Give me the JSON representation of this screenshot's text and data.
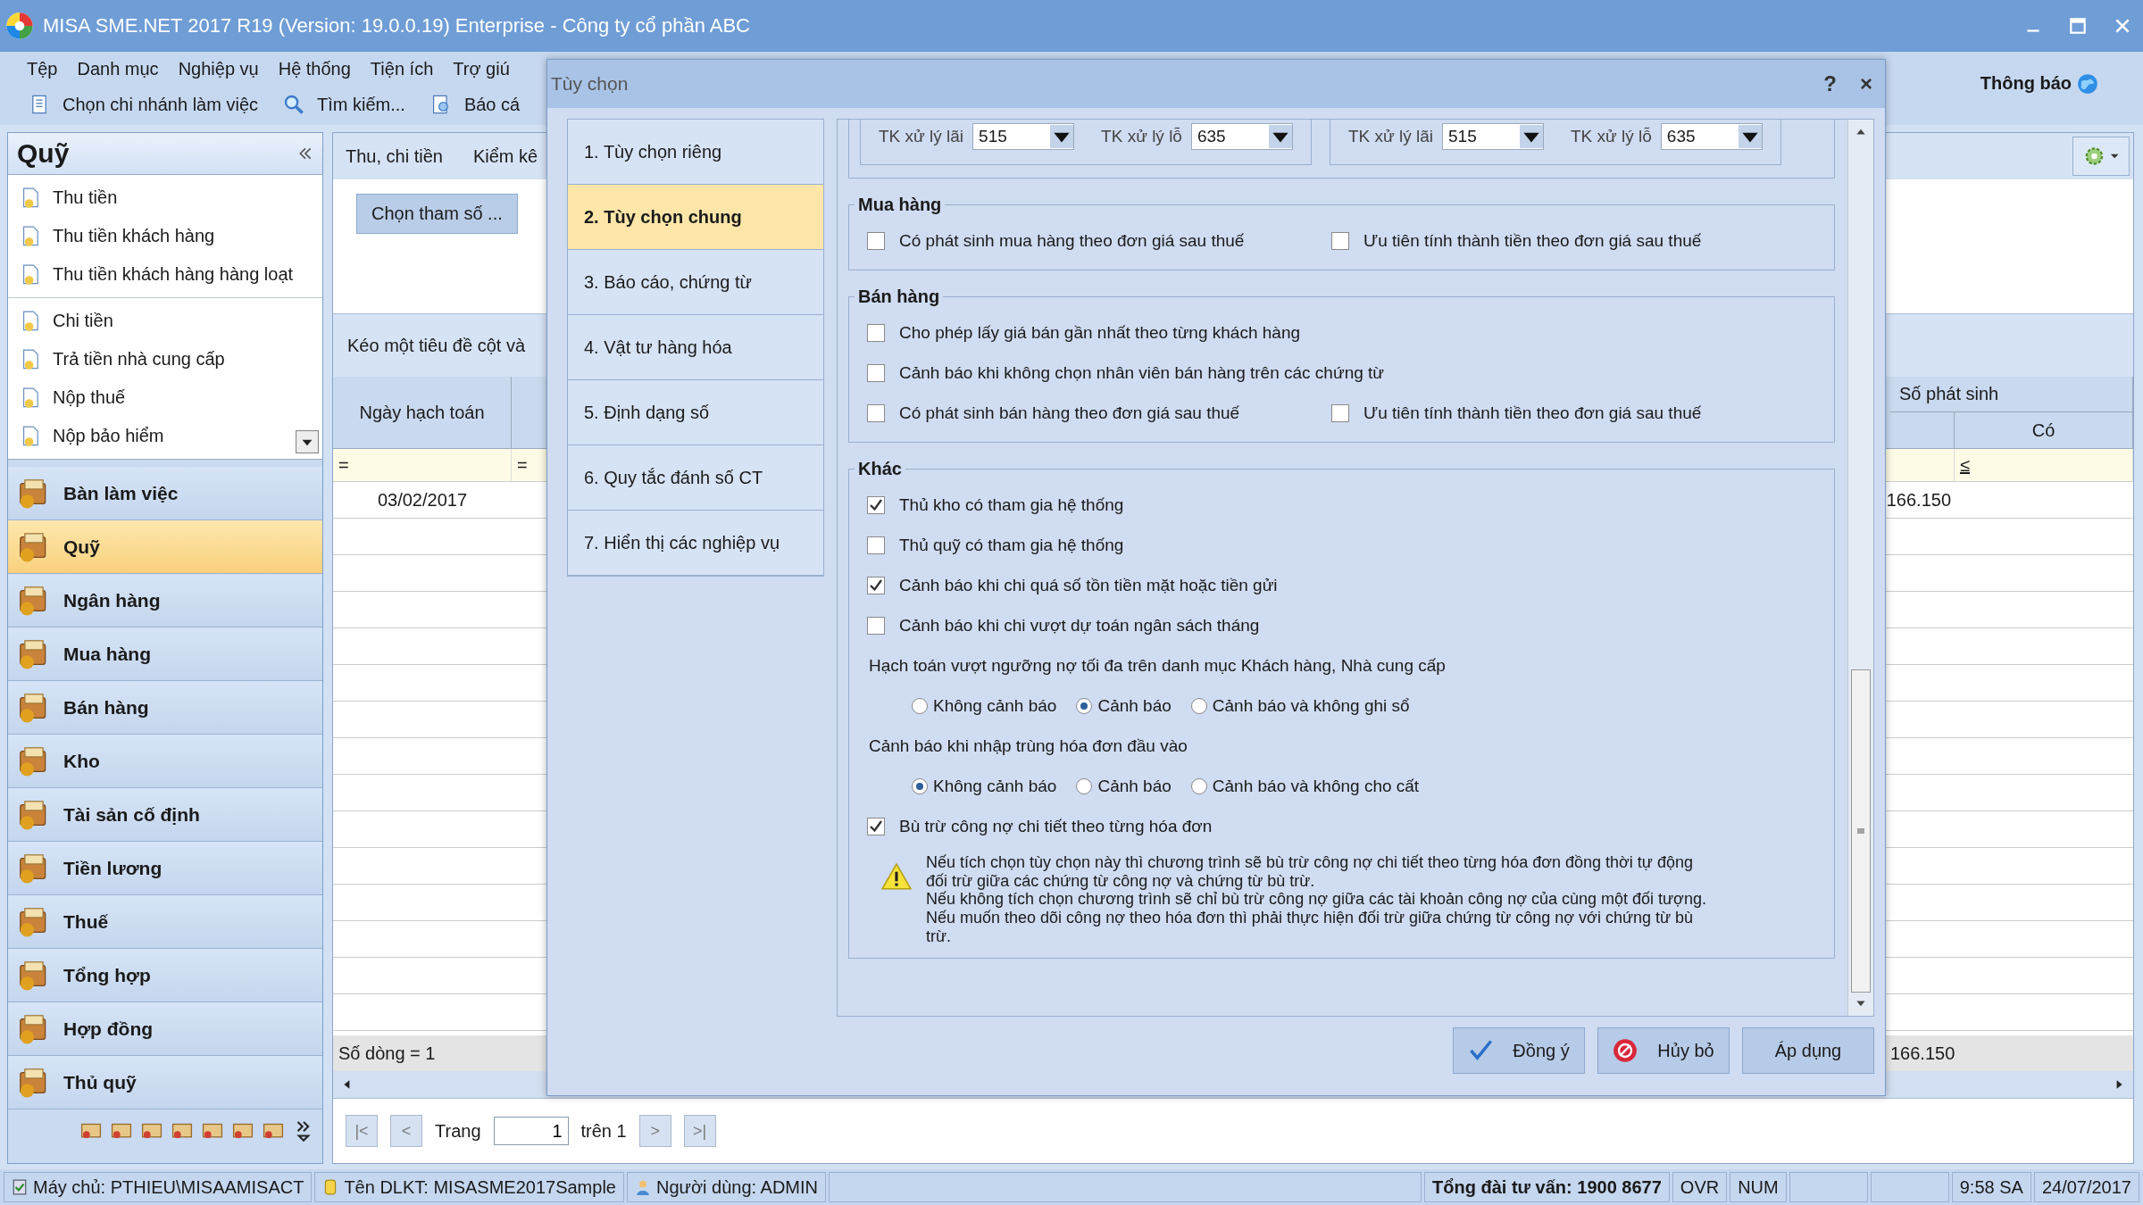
{
  "window": {
    "title": "MISA SME.NET 2017 R19 (Version: 19.0.0.19) Enterprise - Công ty cổ phần ABC"
  },
  "menu": [
    "Tệp",
    "Danh mục",
    "Nghiệp vụ",
    "Hệ thống",
    "Tiện ích",
    "Trợ giú"
  ],
  "toolbar": [
    {
      "kind": "branch",
      "label": "Chọn chi nhánh làm việc"
    },
    {
      "kind": "search",
      "label": "Tìm kiếm..."
    },
    {
      "kind": "report",
      "label": "Báo cá"
    }
  ],
  "notification": "Thông báo",
  "sidebar": {
    "title": "Quỹ",
    "task_groups": [
      [
        "Thu tiền",
        "Thu tiền khách hàng",
        "Thu tiền khách hàng hàng loạt"
      ],
      [
        "Chi tiền",
        "Trả tiền nhà cung cấp",
        "Nộp thuế",
        "Nộp bảo hiểm"
      ]
    ],
    "modules": [
      {
        "label": "Bàn làm việc",
        "selected": false
      },
      {
        "label": "Quỹ",
        "selected": true
      },
      {
        "label": "Ngân hàng",
        "selected": false
      },
      {
        "label": "Mua hàng",
        "selected": false
      },
      {
        "label": "Bán hàng",
        "selected": false
      },
      {
        "label": "Kho",
        "selected": false
      },
      {
        "label": "Tài sản cố định",
        "selected": false
      },
      {
        "label": "Tiền lương",
        "selected": false
      },
      {
        "label": "Thuế",
        "selected": false
      },
      {
        "label": "Tổng hợp",
        "selected": false
      },
      {
        "label": "Hợp đồng",
        "selected": false
      },
      {
        "label": "Thủ quỹ",
        "selected": false
      }
    ]
  },
  "main": {
    "tabs": [
      "Thu, chi tiền",
      "Kiểm kê"
    ],
    "params_button": "Chọn tham số ...",
    "group_hint": "Kéo một tiêu đề cột và",
    "grid": {
      "col_date": "Ngày hạch toán",
      "filter_ops": [
        "=",
        "="
      ],
      "date": "03/02/2017",
      "group_header": "Số phát sinh",
      "col_credit": "Có",
      "credit_filter": "≤",
      "amount": "166.150",
      "row_count": "Số dòng = 1",
      "total": "166.150"
    },
    "pager": {
      "first": "|<",
      "prev": "<",
      "page_label": "Trang",
      "page": "1",
      "of": "trên 1",
      "next": ">",
      "last": ">|"
    }
  },
  "dialog": {
    "title": "Tùy chọn",
    "title_buttons": [
      "?",
      "×"
    ],
    "nav": [
      {
        "label": "1. Tùy chọn riêng",
        "selected": false
      },
      {
        "label": "2. Tùy chọn chung",
        "selected": true
      },
      {
        "label": "3. Báo cáo, chứng từ",
        "selected": false
      },
      {
        "label": "4. Vật tư hàng hóa",
        "selected": false
      },
      {
        "label": "5. Định dạng số",
        "selected": false
      },
      {
        "label": "6. Quy tắc đánh số CT",
        "selected": false
      },
      {
        "label": "7. Hiển thị các nghiệp vụ",
        "selected": false
      }
    ],
    "accounts": [
      [
        {
          "label": "TK xử lý lãi",
          "value": "515"
        },
        {
          "label": "TK xử lý lỗ",
          "value": "635"
        }
      ],
      [
        {
          "label": "TK xử lý lãi",
          "value": "515"
        },
        {
          "label": "TK xử lý lỗ",
          "value": "635"
        }
      ]
    ],
    "sections": [
      {
        "title": "Mua hàng",
        "rows": [
          [
            {
              "label": "Có phát sinh mua hàng theo đơn giá sau thuế",
              "checked": false
            },
            {
              "label": "Ưu tiên tính thành tiền theo đơn giá sau thuế",
              "checked": false
            }
          ]
        ]
      },
      {
        "title": "Bán hàng",
        "rows": [
          [
            {
              "label": "Cho phép lấy giá bán gần nhất theo từng khách hàng",
              "checked": false
            }
          ],
          [
            {
              "label": "Cảnh báo khi không chọn nhân viên bán hàng trên các chứng từ",
              "checked": false
            }
          ],
          [
            {
              "label": "Có phát sinh bán hàng theo đơn giá sau thuế",
              "checked": false
            },
            {
              "label": "Ưu tiên tính thành tiền theo đơn giá sau thuế",
              "checked": false
            }
          ]
        ]
      }
    ],
    "other": {
      "title": "Khác",
      "items": [
        {
          "kind": "checkbox",
          "label": "Thủ kho có tham gia hệ thống",
          "checked": true
        },
        {
          "kind": "checkbox",
          "label": "Thủ quỹ có tham gia hệ thống",
          "checked": false
        },
        {
          "kind": "checkbox",
          "label": "Cảnh báo khi chi quá số tồn tiền mặt hoặc tiền gửi",
          "checked": true
        },
        {
          "kind": "checkbox",
          "label": "Cảnh báo khi chi vượt dự toán ngân sách tháng",
          "checked": false
        },
        {
          "kind": "label",
          "label": "Hạch toán vượt ngưỡng nợ tối đa trên danh mục Khách hàng, Nhà cung cấp"
        },
        {
          "kind": "radios",
          "options": [
            {
              "label": "Không cảnh báo",
              "selected": false
            },
            {
              "label": "Cảnh báo",
              "selected": true
            },
            {
              "label": "Cảnh báo và không ghi sổ",
              "selected": false
            }
          ]
        },
        {
          "kind": "label",
          "label": "Cảnh báo khi nhập trùng hóa đơn đầu vào"
        },
        {
          "kind": "radios",
          "options": [
            {
              "label": "Không cảnh báo",
              "selected": true
            },
            {
              "label": "Cảnh báo",
              "selected": false
            },
            {
              "label": "Cảnh báo và không cho cất",
              "selected": false
            }
          ]
        },
        {
          "kind": "checkbox",
          "label": "Bù trừ công nợ chi tiết theo từng hóa đơn",
          "checked": true
        },
        {
          "kind": "note",
          "paragraphs": [
            "Nếu tích chọn tùy chọn này thì chương trình sẽ bù trừ công nợ chi tiết theo từng hóa đơn đồng thời tự động đối trừ giữa các chứng từ công nợ và chứng từ bù trừ.",
            "Nếu không tích chọn chương trình sẽ chỉ bù trừ công nợ giữa các tài khoản công nợ của cùng một đối tượng. Nếu muốn theo dõi công nợ theo hóa đơn thì phải thực hiện đối trừ giữa chứng từ công nợ với chứng từ bù trừ."
          ]
        }
      ]
    },
    "buttons": [
      {
        "kind": "ok",
        "label": "Đồng ý"
      },
      {
        "kind": "cancel",
        "label": "Hủy bỏ"
      },
      {
        "kind": "apply",
        "label": "Áp dụng"
      }
    ]
  },
  "status_bar": {
    "items": [
      {
        "kind": "server",
        "text": "Máy chủ: PTHIEU\\MISAAMISACT"
      },
      {
        "kind": "database",
        "text": "Tên DLKT: MISASME2017Sample"
      },
      {
        "kind": "user",
        "text": "Người dùng: ADMIN"
      }
    ],
    "hotline": "Tổng đài tư vấn: 1900 8677",
    "keys": [
      "OVR",
      "NUM"
    ],
    "time": "9:58 SA",
    "date": "24/07/2017"
  }
}
